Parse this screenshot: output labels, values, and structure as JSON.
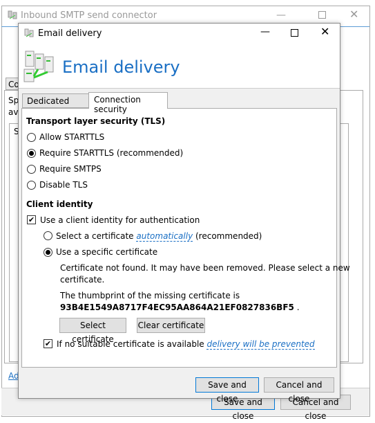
{
  "background_window": {
    "title": "Inbound SMTP send connector",
    "tab_partial": "Co",
    "text_partial_1": "Sp",
    "text_partial_2": "ava",
    "box_partial": "S",
    "link_partial": "Ad",
    "save_label": "Save and close",
    "cancel_label": "Cancel and close"
  },
  "dialog": {
    "title": "Email delivery",
    "header": "Email delivery",
    "tabs": [
      {
        "label": "Dedicated server",
        "active": false
      },
      {
        "label": "Connection security",
        "active": true
      }
    ],
    "tls": {
      "heading": "Transport layer security (TLS)",
      "options": [
        "Allow STARTTLS",
        "Require STARTTLS (recommended)",
        "Require SMTPS",
        "Disable TLS"
      ],
      "selected": "Require STARTTLS (recommended)"
    },
    "client": {
      "heading": "Client identity",
      "use_identity_label": "Use a client identity for authentication",
      "use_identity_checked": true,
      "auto_prefix": "Select a certificate ",
      "auto_link": "automatically",
      "auto_suffix": " (recommended)",
      "specific_label": "Use a specific certificate",
      "selected": "specific",
      "not_found_1": "Certificate not found. It may have been removed. Please select a new",
      "not_found_2": "certificate.",
      "thumb_intro": "The thumbprint of the missing certificate is",
      "thumbprint": "93B4E1549A8717F4EC95AA864A21EF0827836BF5",
      "thumb_end": " .",
      "select_button": "Select certificate",
      "clear_button": "Clear certificate",
      "prevent_prefix": "If no suitable certificate is available ",
      "prevent_link": "delivery will be prevented",
      "prevent_checked": true
    },
    "save_label": "Save and close",
    "cancel_label": "Cancel and close"
  },
  "colors": {
    "accent": "#1a6fc4",
    "default_button_border": "#0078d7"
  }
}
